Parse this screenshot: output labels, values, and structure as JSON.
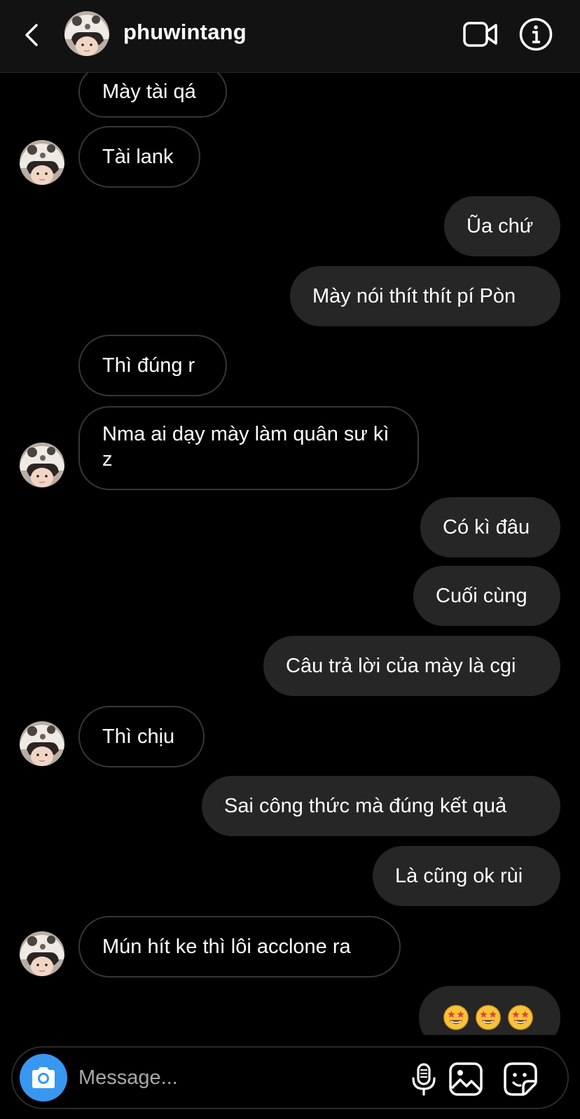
{
  "header": {
    "username": "phuwintang",
    "back_icon": "chevron-left-icon",
    "video_icon": "video-camera-icon",
    "info_icon": "info-icon"
  },
  "messages": [
    {
      "from": "them",
      "text": "Mày tài qá"
    },
    {
      "from": "them",
      "text": "Tài lank"
    },
    {
      "from": "me",
      "text": "Ũa chứ"
    },
    {
      "from": "me",
      "text": "Mày nói thít thít pí Pòn"
    },
    {
      "from": "them",
      "text": "Thì đúng r"
    },
    {
      "from": "them",
      "text": "Nma ai dạy mày làm quân sư kì z"
    },
    {
      "from": "me",
      "text": "Có kì đâu"
    },
    {
      "from": "me",
      "text": "Cuối cùng"
    },
    {
      "from": "me",
      "text": "Câu trả lời của mày là cgi"
    },
    {
      "from": "them",
      "text": "Thì chịu"
    },
    {
      "from": "me",
      "text": "Sai công thức mà đúng kết quả"
    },
    {
      "from": "me",
      "text": "Là cũng ok rùi"
    },
    {
      "from": "them",
      "text": "Mún hít ke thì lôi acclone ra"
    },
    {
      "from": "me",
      "emoji": [
        "star-struck-emoji",
        "star-struck-emoji",
        "star-struck-emoji"
      ]
    }
  ],
  "composer": {
    "placeholder": "Message...",
    "camera_icon": "camera-icon",
    "mic_icon": "microphone-icon",
    "gallery_icon": "image-icon",
    "sticker_icon": "sticker-icon"
  },
  "colors": {
    "background": "#000000",
    "header": "#121212",
    "outgoing_bubble": "#262626",
    "incoming_border": "#363636",
    "camera_button": "#3897f0"
  }
}
